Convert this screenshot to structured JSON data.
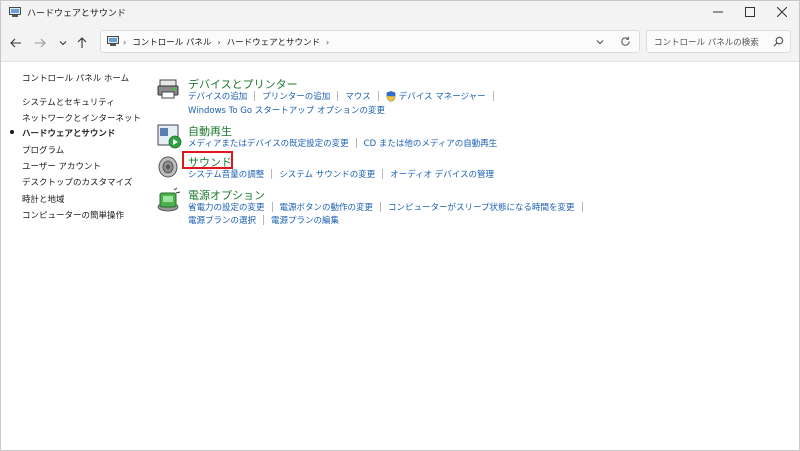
{
  "window": {
    "title": "ハードウェアとサウンド"
  },
  "address": {
    "crumbs": [
      "コントロール パネル",
      "ハードウェアとサウンド"
    ],
    "search_placeholder": "コントロール パネルの検索"
  },
  "leftnav": {
    "home": "コントロール パネル ホーム",
    "items": [
      "システムとセキュリティ",
      "ネットワークとインターネット",
      "ハードウェアとサウンド",
      "プログラム",
      "ユーザー アカウント",
      "デスクトップのカスタマイズ",
      "時計と地域",
      "コンピューターの簡単操作"
    ],
    "current": "ハードウェアとサウンド"
  },
  "categories": [
    {
      "title": "デバイスとプリンター",
      "icon": "printer-icon",
      "links_row1": [
        "デバイスの追加",
        "プリンターの追加",
        "マウス",
        "デバイス マネージャー"
      ],
      "links_row2": [
        "Windows To Go スタートアップ オプションの変更"
      ]
    },
    {
      "title": "自動再生",
      "icon": "autoplay-icon",
      "links_row1": [
        "メディアまたはデバイスの既定設定の変更",
        "CD または他のメディアの自動再生"
      ]
    },
    {
      "title": "サウンド",
      "icon": "speaker-icon",
      "links_row1": [
        "システム音量の調整",
        "システム サウンドの変更",
        "オーディオ デバイスの管理"
      ]
    },
    {
      "title": "電源オプション",
      "icon": "power-options-icon",
      "links_row1": [
        "省電力の設定の変更",
        "電源ボタンの動作の変更",
        "コンピューターがスリープ状態になる時間を変更"
      ],
      "links_row2": [
        "電源プランの選択",
        "電源プランの編集"
      ]
    }
  ],
  "colors": {
    "category_title": "#1e7a2e",
    "link": "#1a5fb4",
    "highlight": "#e0151d"
  }
}
